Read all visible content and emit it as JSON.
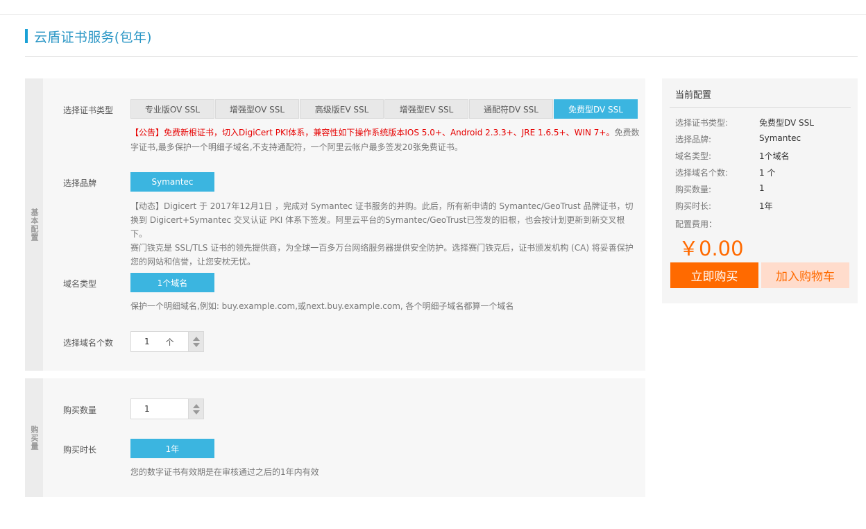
{
  "page": {
    "title": "云盾证书服务(包年)"
  },
  "basic": {
    "side_label": "基本配置",
    "cert_type_label": "选择证书类型",
    "cert_types": [
      "专业版OV SSL",
      "增强型OV SSL",
      "高级版EV SSL",
      "增强型EV SSL",
      "通配符DV SSL",
      "免费型DV SSL"
    ],
    "cert_type_selected": "免费型DV SSL",
    "notice_red": "【公告】免费新根证书，切入DigiCert PKI体系，兼容性如下操作系统版本IOS 5.0+、Android 2.3.3+、JRE 1.6.5+、WIN 7+。",
    "notice_gray": "免费数字证书,最多保护一个明细子域名,不支持通配符，一个阿里云帐户最多签发20张免费证书。",
    "brand_label": "选择品牌",
    "brand_value": "Symantec",
    "brand_desc_1": "【动态】Digicert 于 2017年12月1日 ，完成对 Symantec 证书服务的并购。此后，所有新申请的 Symantec/GeoTrust 品牌证书，切换到 Digicert+Symantec 交叉认证 PKI 体系下签发。阿里云平台的Symantec/GeoTrust已签发的旧根，也会按计划更新到新交叉根下。",
    "brand_desc_2": "赛门铁克是 SSL/TLS 证书的领先提供商，为全球一百多万台网络服务器提供安全防护。选择赛门铁克后，证书颁发机构 (CA) 将妥善保护您的网站和信誉，让您安枕无忧。",
    "domain_type_label": "域名类型",
    "domain_type_value": "1个域名",
    "domain_type_desc": "保护一个明细域名,例如: buy.example.com,或next.buy.example.com, 各个明细子域名都算一个域名",
    "domain_count_label": "选择域名个数",
    "domain_count_value": "1",
    "domain_count_unit": "个"
  },
  "buy": {
    "side_label": "购买量",
    "qty_label": "购买数量",
    "qty_value": "1",
    "duration_label": "购买时长",
    "duration_value": "1年",
    "duration_desc": "您的数字证书有效期是在审核通过之后的1年内有效"
  },
  "summary": {
    "title": "当前配置",
    "rows": [
      {
        "label": "选择证书类型:",
        "value": "免费型DV SSL"
      },
      {
        "label": "选择品牌:",
        "value": "Symantec"
      },
      {
        "label": "域名类型:",
        "value": "1个域名"
      },
      {
        "label": "选择域名个数:",
        "value": "1 个"
      },
      {
        "label": "购买数量:",
        "value": "1"
      },
      {
        "label": "购买时长:",
        "value": "1年"
      }
    ],
    "fee_label": "配置费用：",
    "price": "￥0.00",
    "buy_button": "立即购买",
    "cart_button": "加入购物车"
  },
  "colors": {
    "accent": "#3bb5e0",
    "orange": "#ff6a00",
    "title_blue": "#2a96c5"
  }
}
